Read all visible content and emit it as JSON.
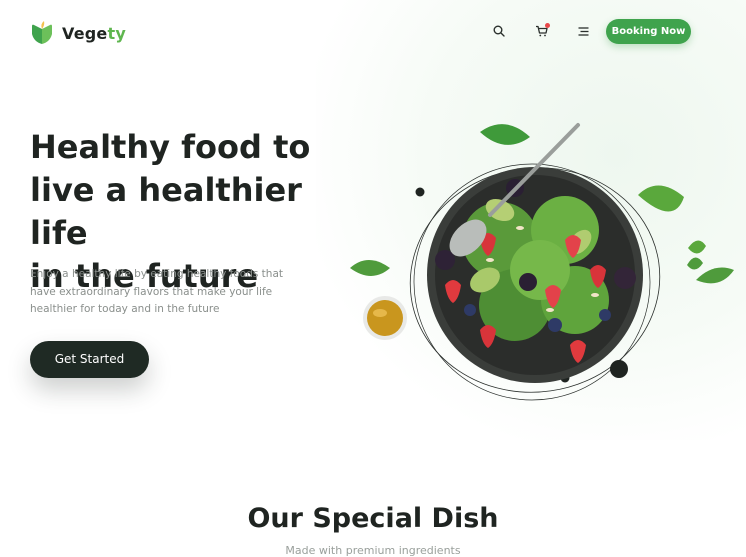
{
  "brand": {
    "name_prefix": "Vege",
    "name_suffix": "ty",
    "accent_color": "#5fb64f"
  },
  "nav": {
    "icons": [
      "search-icon",
      "cart-icon",
      "menu-icon"
    ],
    "booking_label": "Booking Now",
    "booking_color": "#3fa34d"
  },
  "hero": {
    "title_line1": "Healthy food to",
    "title_line2": "live a healthier life",
    "title_line3": "in the future",
    "description": "Enjoy a healthy life by eating healthy foods that have extraordinary flavors that make your life healthier for today and in the future",
    "cta_label": "Get Started",
    "cta_color": "#1f2a24"
  },
  "section": {
    "title": "Our Special Dish",
    "subtitle": "Made with premium ingredients"
  }
}
